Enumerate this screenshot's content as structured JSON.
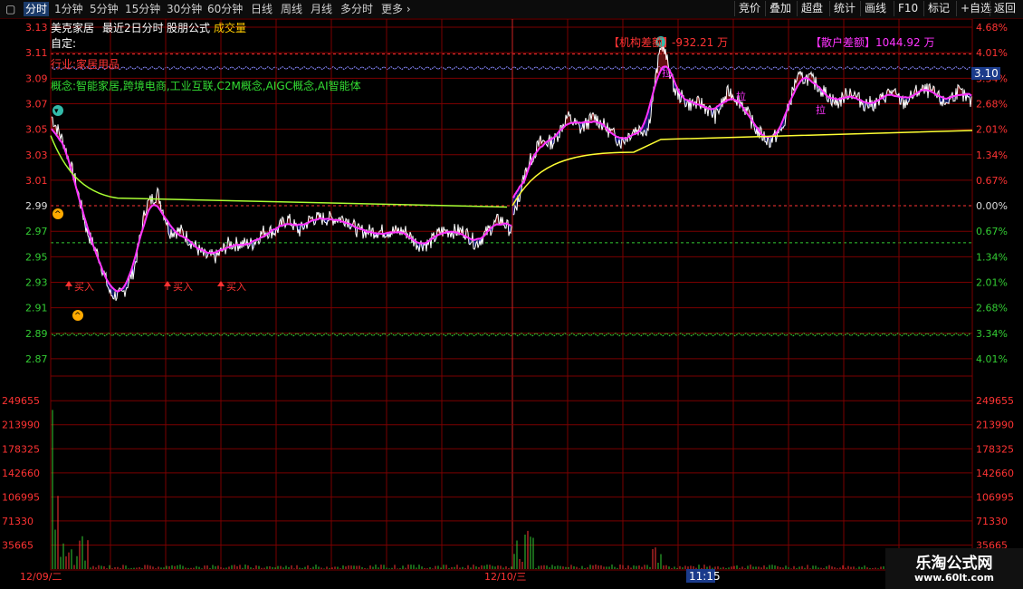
{
  "toolbar": {
    "left_items": [
      "分时",
      "1分钟",
      "5分钟",
      "15分钟",
      "30分钟",
      "60分钟",
      "日线",
      "周线",
      "月线",
      "多分时",
      "更多"
    ],
    "active": "分时",
    "right_items": [
      "竞价",
      "叠加",
      "超盘",
      "统计",
      "画线",
      "F10",
      "标记",
      "+自选",
      "返回"
    ]
  },
  "header": {
    "stock_name": "美克家居",
    "period_label": "最近2日分时",
    "formula_label": "股朋公式",
    "volume_label": "成交量"
  },
  "info": {
    "custom": "自定:",
    "industry": "行业:家居用品",
    "concepts": "概念:智能家居,跨境电商,工业互联,C2M概念,AIGC概念,AI智能体"
  },
  "annotations": {
    "institution_label": "【机构差额】",
    "institution_value": "-932.21 万",
    "retail_label": "【散户差额】",
    "retail_value": "1044.92 万",
    "buy_label": "买入",
    "pull_label": "拉",
    "current_price": "3.10",
    "time_cursor": "11:15"
  },
  "colors": {
    "price_line": "#ffffff",
    "avg_line": "#ff33ff",
    "ma_line": "#ffff33",
    "up": "#ff3333",
    "down": "#3333ff",
    "grid": "#7a0000",
    "accent_green": "#33cc33",
    "accent_red": "#ff2222"
  },
  "chart_data": {
    "type": "line",
    "title": "美克家居 最近2日分时",
    "price_axis": {
      "ticks": [
        "3.13",
        "3.11",
        "3.09",
        "3.07",
        "3.05",
        "3.03",
        "3.01",
        "2.99",
        "2.97",
        "2.95",
        "2.93",
        "2.91",
        "2.89",
        "2.87"
      ],
      "ylim": [
        2.86,
        3.135
      ],
      "prev_close": 2.99
    },
    "pct_axis": {
      "ticks": [
        "4.68%",
        "4.01%",
        "3.34%",
        "2.68%",
        "2.01%",
        "1.34%",
        "0.67%",
        "0.00%",
        "0.67%",
        "1.34%",
        "2.01%",
        "2.68%",
        "3.34%",
        "4.01%"
      ]
    },
    "volume_axis": {
      "ticks": [
        "249655",
        "213990",
        "178325",
        "142660",
        "106995",
        "71330",
        "35665"
      ]
    },
    "x_labels": [
      "12/09/二",
      "12/10/三"
    ],
    "series": [
      {
        "name": "价格",
        "day": 1,
        "values": [
          3.06,
          3.04,
          3.01,
          2.97,
          2.95,
          2.92,
          2.92,
          2.94,
          2.99,
          3.0,
          2.97,
          2.97,
          2.96,
          2.95,
          2.95,
          2.96,
          2.96,
          2.96,
          2.97,
          2.97,
          2.98,
          2.97,
          2.98,
          2.98,
          2.98,
          2.98,
          2.97,
          2.97,
          2.97,
          2.97,
          2.97,
          2.96,
          2.96,
          2.97,
          2.97,
          2.97,
          2.96,
          2.97,
          2.98,
          2.97
        ]
      },
      {
        "name": "价格",
        "day": 2,
        "values": [
          2.98,
          3.02,
          3.04,
          3.04,
          3.06,
          3.05,
          3.06,
          3.05,
          3.04,
          3.05,
          3.05,
          3.12,
          3.08,
          3.07,
          3.07,
          3.06,
          3.08,
          3.07,
          3.05,
          3.04,
          3.05,
          3.09,
          3.09,
          3.08,
          3.07,
          3.08,
          3.07,
          3.07,
          3.08,
          3.07,
          3.08,
          3.08,
          3.07,
          3.08,
          3.07
        ]
      }
    ]
  }
}
